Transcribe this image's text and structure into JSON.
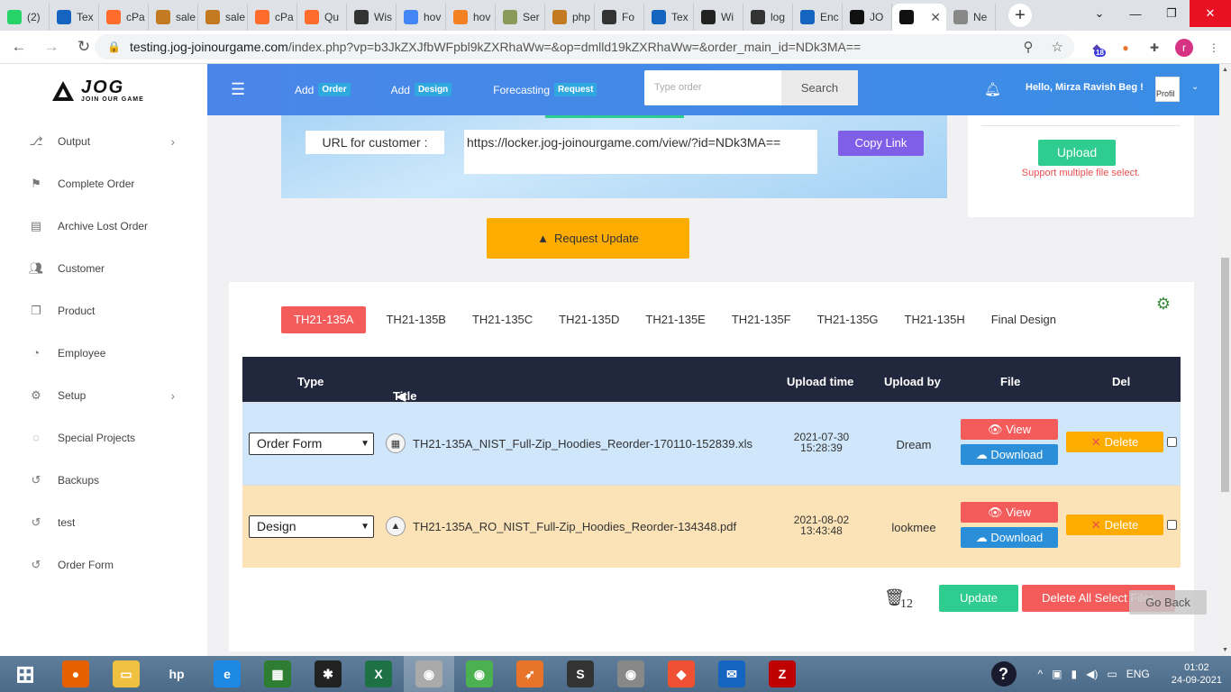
{
  "browser": {
    "tabs": [
      {
        "label": "(2)",
        "icon": "whatsapp-icon",
        "color": "#25d366"
      },
      {
        "label": "Tex",
        "icon": "t-icon",
        "color": "#1565c0"
      },
      {
        "label": "cPa",
        "icon": "cpanel-icon",
        "color": "#ff6c2c"
      },
      {
        "label": "sale",
        "icon": "logo-icon",
        "color": "#c47a20"
      },
      {
        "label": "sale",
        "icon": "logo-icon",
        "color": "#c47a20"
      },
      {
        "label": "cPa",
        "icon": "cpanel-icon",
        "color": "#ff6c2c"
      },
      {
        "label": "Qu",
        "icon": "cpanel-icon",
        "color": "#ff6c2c"
      },
      {
        "label": "Wis",
        "icon": "globe-icon",
        "color": "#333333"
      },
      {
        "label": "hov",
        "icon": "google-icon",
        "color": "#4285f4"
      },
      {
        "label": "hov",
        "icon": "stackoverflow-icon",
        "color": "#f48024"
      },
      {
        "label": "Ser",
        "icon": "avatar-icon",
        "color": "#8a9a5b"
      },
      {
        "label": "php",
        "icon": "logo-icon",
        "color": "#c47a20"
      },
      {
        "label": "Fo",
        "icon": "globe-icon",
        "color": "#333333"
      },
      {
        "label": "Tex",
        "icon": "t-icon",
        "color": "#1565c0"
      },
      {
        "label": "Wi",
        "icon": "home-icon",
        "color": "#222222"
      },
      {
        "label": "log",
        "icon": "globe-icon",
        "color": "#333333"
      },
      {
        "label": "Enc",
        "icon": "t-icon",
        "color": "#1565c0"
      },
      {
        "label": "JO",
        "icon": "jog-icon",
        "color": "#111111"
      },
      {
        "label": "",
        "icon": "jog-icon",
        "color": "#111111",
        "active": true
      },
      {
        "label": "Ne",
        "icon": "chrome-icon",
        "color": "#888888"
      }
    ],
    "url_host": "testing.jog-joinourgame.com",
    "url_path": "/index.php?vp=b3JkZXJfbWFpbl9kZXRhaWw=&op=dmlld19kZXRhaWw=&order_main_id=NDk3MA==",
    "ext_badge": "18",
    "profile_letter": "r"
  },
  "sidebar": {
    "logo_text": "JOG",
    "logo_sub": "JOIN OUR GAME",
    "items": [
      {
        "label": "Output",
        "icon": "output-icon",
        "chevron": true
      },
      {
        "label": "Complete Order",
        "icon": "flag-icon",
        "chevron": false
      },
      {
        "label": "Archive Lost Order",
        "icon": "archive-icon",
        "chevron": false
      },
      {
        "label": "Customer",
        "icon": "users-icon",
        "chevron": false
      },
      {
        "label": "Product",
        "icon": "copy-icon",
        "chevron": false
      },
      {
        "label": "Employee",
        "icon": "dashboard-icon",
        "chevron": false
      },
      {
        "label": "Setup",
        "icon": "gears-icon",
        "chevron": true
      },
      {
        "label": "Special Projects",
        "icon": "lightbulb-icon",
        "chevron": false
      },
      {
        "label": "Backups",
        "icon": "history-icon",
        "chevron": false
      },
      {
        "label": "test",
        "icon": "history-icon",
        "chevron": false
      },
      {
        "label": "Order Form",
        "icon": "history-icon",
        "chevron": false
      }
    ]
  },
  "topnav": {
    "add_order": "Add",
    "add_order_badge": "Order",
    "add_design": "Add",
    "add_design_badge": "Design",
    "forecasting": "Forecasting",
    "forecasting_badge": "Request",
    "search_placeholder": "Type order",
    "search_button": "Search",
    "greeting": "Hello, Mirza Ravish Beg !",
    "profile_alt": "Profil"
  },
  "share": {
    "url_label": "URL for customer :",
    "url_value": "https://locker.jog-joinourgame.com/view/?id=NDk3MA==",
    "copy_button": "Copy Link"
  },
  "upload": {
    "button": "Upload",
    "note": "Support multiple file select."
  },
  "request_update": "Request Update",
  "design_tabs": [
    "TH21-135A",
    "TH21-135B",
    "TH21-135C",
    "TH21-135D",
    "TH21-135E",
    "TH21-135F",
    "TH21-135G",
    "TH21-135H",
    "Final Design"
  ],
  "table": {
    "headers": {
      "type": "Type",
      "title": "Title",
      "upload_time": "Upload time",
      "upload_by": "Upload by",
      "file": "File",
      "del": "Del"
    },
    "rows": [
      {
        "type": "Order Form",
        "icon": "spreadsheet-icon",
        "title": "TH21-135A_NIST_Full-Zip_Hoodies_Reorder-170110-152839.xls",
        "date": "2021-07-30",
        "time": "15:28:39",
        "by": "Dream"
      },
      {
        "type": "Design",
        "icon": "jog-icon",
        "title": "TH21-135A_RO_NIST_Full-Zip_Hoodies_Reorder-134348.pdf",
        "date": "2021-08-02",
        "time": "13:43:48",
        "by": "lookmee"
      }
    ],
    "view_label": "View",
    "download_label": "Download",
    "delete_label": "Delete"
  },
  "footer": {
    "trash_count": "12",
    "update_button": "Update",
    "delete_all_button": "Delete All Select Files",
    "go_back": "Go Back"
  },
  "taskbar": {
    "apps": [
      "start-icon",
      "firefox-icon",
      "file-explorer-icon",
      "hp-icon",
      "ie-icon",
      "store-icon",
      "puzzle-icon",
      "excel-icon",
      "chrome-profile-icon",
      "chrome-icon",
      "rocket-icon",
      "sublime-icon",
      "chrome-alt-icon",
      "git-icon",
      "mail-icon",
      "filezilla-icon"
    ],
    "lang": "ENG",
    "time": "01:02",
    "date": "24-09-2021"
  }
}
